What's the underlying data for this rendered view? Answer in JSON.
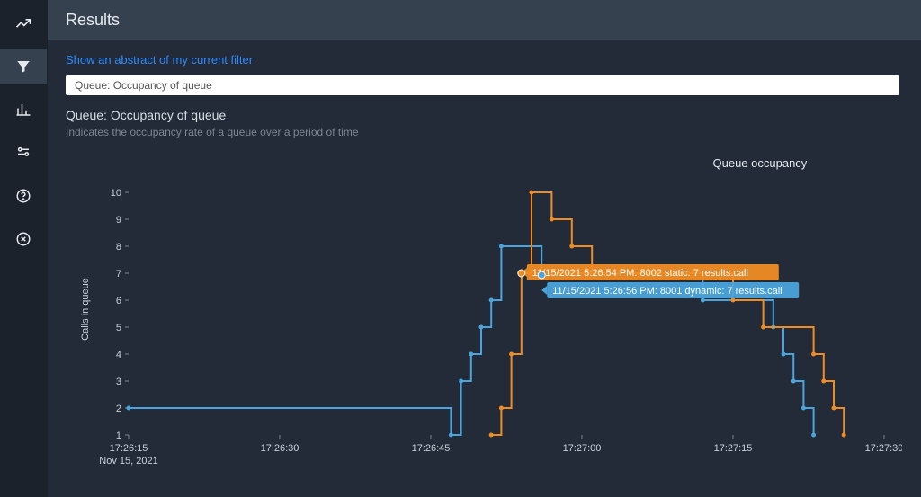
{
  "header": {
    "title": "Results"
  },
  "links": {
    "abstract": "Show an abstract of my current filter"
  },
  "search": {
    "value": "Queue: Occupancy of queue"
  },
  "panel": {
    "title": "Queue: Occupancy of queue",
    "subtitle": "Indicates the occupancy rate of a queue over a period of time"
  },
  "chart_data": {
    "type": "line",
    "title": "Queue occupancy",
    "ylabel": "Calls in queue",
    "xlabel": "",
    "y_ticks": [
      1,
      2,
      3,
      4,
      5,
      6,
      7,
      8,
      9,
      10
    ],
    "x_ticks": [
      "17:26:15",
      "17:26:30",
      "17:26:45",
      "17:27:00",
      "17:27:15",
      "17:27:30"
    ],
    "x_date": "Nov 15, 2021",
    "x_range_sec": [
      975,
      1050
    ],
    "ylim": [
      1,
      10
    ],
    "colors": {
      "8001 dynamic": "#4ba4db",
      "8002 static": "#f08c24"
    },
    "step_mode": "post",
    "series": [
      {
        "name": "8001 dynamic",
        "points": [
          {
            "x": 975,
            "y": 2
          },
          {
            "x": 1007,
            "y": 1
          },
          {
            "x": 1008,
            "y": 3
          },
          {
            "x": 1009,
            "y": 4
          },
          {
            "x": 1010,
            "y": 5
          },
          {
            "x": 1011,
            "y": 6
          },
          {
            "x": 1012,
            "y": 8
          },
          {
            "x": 1016,
            "y": 7
          },
          {
            "x": 1032,
            "y": 6
          },
          {
            "x": 1039,
            "y": 5
          },
          {
            "x": 1040,
            "y": 4
          },
          {
            "x": 1041,
            "y": 3
          },
          {
            "x": 1042,
            "y": 2
          },
          {
            "x": 1043,
            "y": 1
          }
        ]
      },
      {
        "name": "8002 static",
        "points": [
          {
            "x": 1011,
            "y": 1
          },
          {
            "x": 1012,
            "y": 2
          },
          {
            "x": 1013,
            "y": 4
          },
          {
            "x": 1014,
            "y": 7
          },
          {
            "x": 1015,
            "y": 10
          },
          {
            "x": 1017,
            "y": 9
          },
          {
            "x": 1019,
            "y": 8
          },
          {
            "x": 1021,
            "y": 7
          },
          {
            "x": 1035,
            "y": 6
          },
          {
            "x": 1038,
            "y": 5
          },
          {
            "x": 1043,
            "y": 4
          },
          {
            "x": 1044,
            "y": 3
          },
          {
            "x": 1045,
            "y": 2
          },
          {
            "x": 1046,
            "y": 1
          }
        ]
      }
    ],
    "tooltips": [
      {
        "series": "8002 static",
        "text": "11/15/2021 5:26:54 PM: 8002 static: 7 results.call",
        "at": {
          "x": 1014,
          "y": 7
        }
      },
      {
        "series": "8001 dynamic",
        "text": "11/15/2021 5:26:56 PM: 8001 dynamic: 7 results.call",
        "at": {
          "x": 1016,
          "y": 7
        }
      }
    ]
  }
}
